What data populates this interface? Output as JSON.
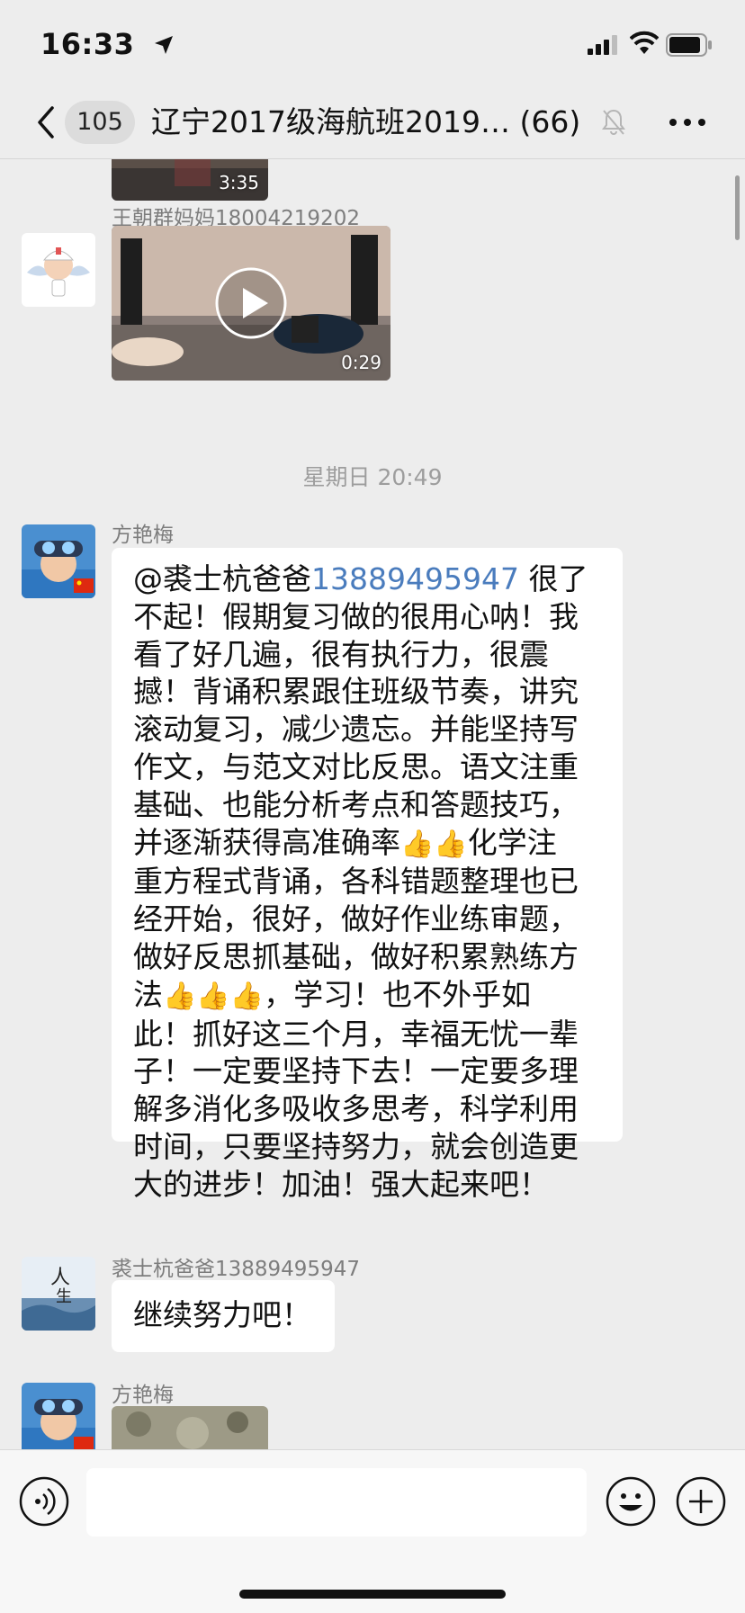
{
  "status_bar": {
    "time": "16:33"
  },
  "nav": {
    "badge_count": "105",
    "title": "辽宁2017级海航班2019… (66)"
  },
  "messages": [
    {
      "type": "video",
      "duration": "3:35"
    },
    {
      "type": "video",
      "sender": "王朝群妈妈18004219202",
      "duration": "0:29"
    },
    {
      "type": "timestamp",
      "text": "星期日 20:49"
    },
    {
      "type": "text",
      "sender": "方艳梅",
      "mention": "@裘士杭爸爸",
      "mention_link": "13889495947",
      "text_1": " 很了\n不起！假期复习做的很用心呐！我\n看了好几遍，很有执行力，很震\n撼！背诵积累跟住班级节奏，讲究\n滚动复习，减少遗忘。并能坚持写\n作文，与范文对比反思。语文注重\n基础、也能分析考点和答题技巧，\n并逐渐获得高准确率",
      "emoji_1": "👍👍",
      "text_2": "化学注\n重方程式背诵，各科错题整理也已\n经开始，很好，做好作业练审题，\n做好反思抓基础，做好积累熟练方\n法",
      "emoji_2": "👍👍👍",
      "text_3": "，学习！也不外乎如\n此！抓好这三个月，幸福无忧一辈\n子！一定要坚持下去！一定要多理\n解多消化多吸收多思考，科学利用\n时间，只要坚持努力，就会创造更\n大的进步！加油！强大起来吧！"
    },
    {
      "type": "text",
      "sender": "裘士杭爸爸13889495947",
      "text": "继续努力吧！"
    },
    {
      "type": "image",
      "sender": "方艳梅"
    }
  ],
  "input": {
    "value": "",
    "placeholder": ""
  },
  "icons": {
    "back": "chevron-left-icon",
    "location": "location-arrow-icon",
    "mute": "bell-slash-icon",
    "more": "more-dots-icon",
    "voice": "voice-icon",
    "emoji": "smiley-icon",
    "plus": "plus-icon"
  },
  "colors": {
    "background": "#ededed",
    "link": "#4a7cbd",
    "bubble": "#ffffff"
  }
}
